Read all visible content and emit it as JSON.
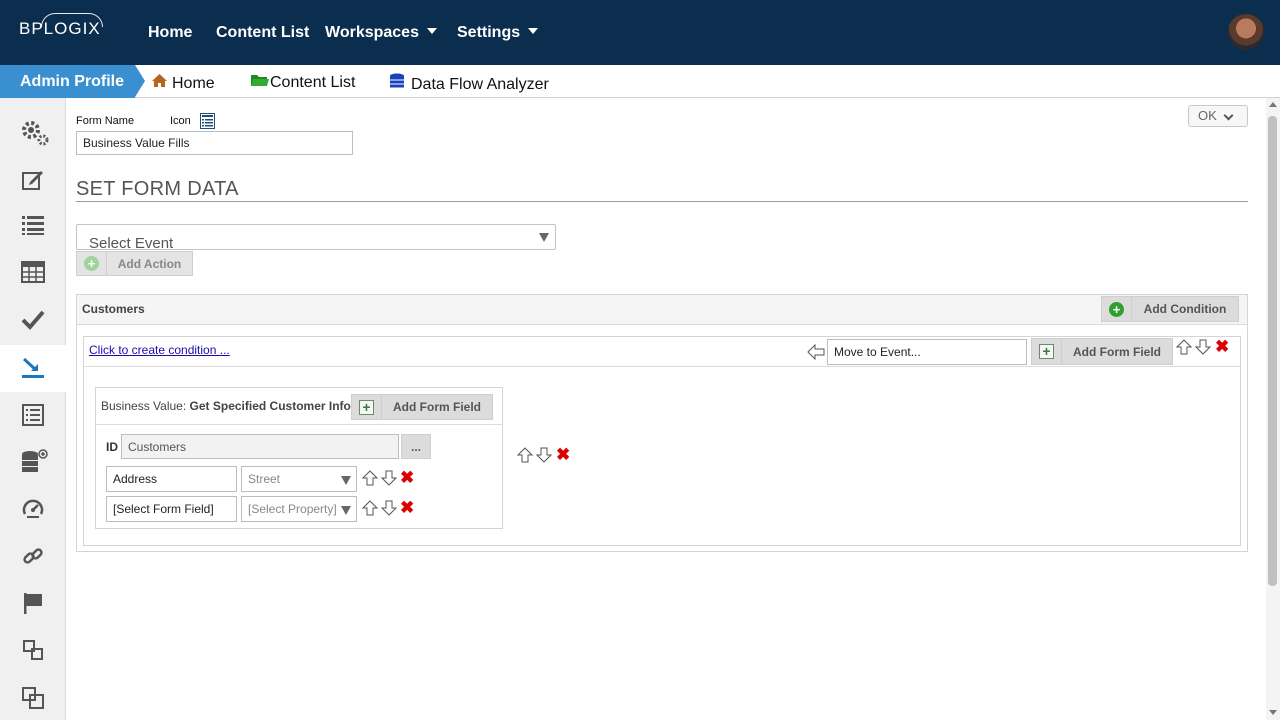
{
  "topbar": {
    "logo": "BPLOGIX",
    "nav": [
      {
        "label": "Home"
      },
      {
        "label": "Content List"
      },
      {
        "label": "Workspaces"
      },
      {
        "label": "Settings"
      }
    ]
  },
  "breadcrumb": {
    "profile": "Admin Profile",
    "items": [
      {
        "label": "Home",
        "icon": "home-icon"
      },
      {
        "label": "Content List",
        "icon": "folder-icon"
      },
      {
        "label": "Data Flow Analyzer",
        "icon": "database-icon"
      }
    ]
  },
  "sidebar": {
    "icons": [
      "gears-icon",
      "edit-icon",
      "list-icon",
      "table-icon",
      "check-icon",
      "import-icon",
      "form-list-icon",
      "database-add-icon",
      "dashboard-icon",
      "link-icon",
      "flag-icon",
      "split-icon",
      "copy-icon"
    ],
    "active": "import-icon"
  },
  "form": {
    "name_label": "Form Name",
    "icon_label": "Icon",
    "name_value": "Business Value Fills",
    "ok_label": "OK",
    "section_title": "SET FORM DATA",
    "event_placeholder": "Select Event",
    "add_action_label": "Add Action"
  },
  "condition_panel": {
    "title": "Customers",
    "add_condition_label": "Add Condition",
    "create_condition_link": "Click to create condition ...",
    "move_to_event_placeholder": "Move to Event...",
    "add_form_field_label": "Add Form Field"
  },
  "business_value": {
    "prefix": "Business Value:",
    "name": "Get Specified Customer Info",
    "add_form_field_label": "Add Form Field",
    "id_label": "ID",
    "id_value": "Customers",
    "browse_label": "...",
    "rows": [
      {
        "field": "Address",
        "property": "Street"
      },
      {
        "field": "[Select Form Field]",
        "property": "[Select Property]"
      }
    ]
  },
  "colors": {
    "topbar": "#0b2e4f",
    "admin_tab": "#3a8fd0",
    "delete": "#dd0000",
    "add": "#2fa02f"
  }
}
